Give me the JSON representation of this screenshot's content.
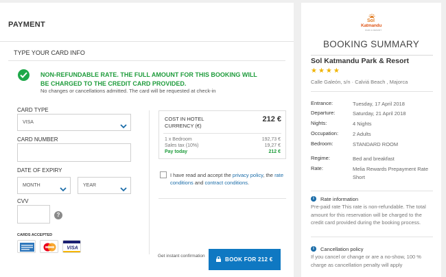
{
  "payment": {
    "header": "PAYMENT",
    "card_info_title": "TYPE YOUR CARD INFO",
    "notice_title": "NON-REFUNDABLE RATE. THE FULL AMOUNT FOR THIS BOOKING WILL BE CHARGED TO THE CREDIT CARD PROVIDED.",
    "notice_sub": "No changes or cancellations admitted. The card will be requested at check-in",
    "card_type_label": "CARD TYPE",
    "card_type_value": "VISA",
    "card_number_label": "CARD NUMBER",
    "card_number_value": "",
    "expiry_label": "DATE OF EXPIRY",
    "month_value": "MONTH",
    "year_value": "YEAR",
    "cvv_label": "CVV",
    "cvv_value": "",
    "help_glyph": "?",
    "cards_accepted_label": "CARDS ACCEPTED",
    "cards_accepted": [
      "American Express",
      "MasterCard",
      "VISA"
    ]
  },
  "cost": {
    "title": "COST IN HOTEL CURRENCY (€)",
    "total": "212 €",
    "rows": [
      {
        "label": "1 x Bedroom",
        "amount": "192,73 €"
      },
      {
        "label": "Sales tax (10%)",
        "amount": "19,27 €"
      },
      {
        "label": "Pay today",
        "amount": "212 €"
      }
    ]
  },
  "terms": {
    "prefix": "I have read and accept the ",
    "privacy_link": "privacy policy",
    "comma": ", the ",
    "rate_link": "rate conditions",
    "and": " and ",
    "contract_link": "contract conditions",
    "suffix": ".",
    "checked": false
  },
  "footer": {
    "instant_confirmation": "Get instant confirmation",
    "book_button": "BOOK FOR 212 €"
  },
  "summary": {
    "logo_line1": "Sol",
    "logo_line2": "Katmandu",
    "logo_line3": "PARK & RESORT",
    "title": "BOOKING SUMMARY",
    "hotel_name": "Sol Katmandu Park & Resort",
    "stars": "★★★★",
    "address": "Calle Galeón, s/n · Calviá Beach , Majorca",
    "details": [
      {
        "key": "Entrance:",
        "value": "Tuesday, 17 April 2018"
      },
      {
        "key": "Departure:",
        "value": "Saturday, 21 April 2018"
      },
      {
        "key": "Nights:",
        "value": "4 Nights"
      },
      {
        "key": "Occupation:",
        "value": "2 Adults"
      },
      {
        "key": "Bedroom:",
        "value": "STANDARD ROOM"
      },
      {
        "key": "Regime:",
        "value": "Bed and breakfast"
      },
      {
        "key": "Rate:",
        "value": "Melia Rewards Prepayment Rate Short"
      }
    ],
    "rate_info_title": "Rate information",
    "rate_info_body": "Pre-paid rate This rate is non-refundable. The total amount for this reservation will be charged to the credit card provided during the booking process.",
    "cancel_title": "Cancellation policy",
    "cancel_body": "If you cancel or change or are a no-show, 100 % charge as cancellation penalty will apply",
    "info_glyph": "i"
  },
  "colors": {
    "accent_blue": "#0f78c2",
    "success_green": "#1f9c3c",
    "star_yellow": "#f0b400",
    "logo_orange": "#e07b22"
  },
  "icons": [
    "check-circle-icon",
    "chevron-down-icon",
    "help-icon",
    "lock-icon",
    "info-icon",
    "amex-card-icon",
    "mastercard-icon",
    "visa-card-icon"
  ]
}
